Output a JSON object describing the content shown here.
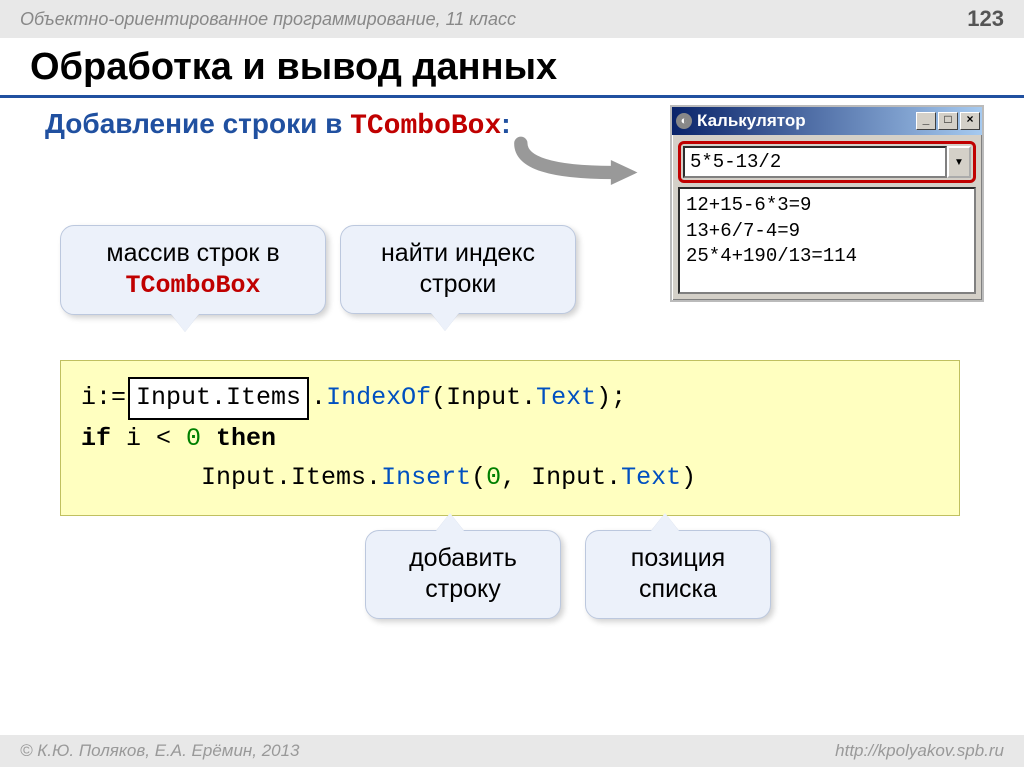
{
  "header": {
    "course": "Объектно-ориентированное программирование, 11 класс",
    "page": "123"
  },
  "title": "Обработка и вывод данных",
  "subtitle": {
    "prefix": "Добавление строки в ",
    "classname": "TComboBox",
    "suffix": ":"
  },
  "window": {
    "title": "Калькулятор",
    "combo_value": "5*5-13/2",
    "list": "12+15-6*3=9\n13+6/7-4=9\n25*4+190/13=114"
  },
  "callouts": {
    "arrayLines": {
      "l1": "массив строк в",
      "l2": "TComboBox"
    },
    "findIndex": {
      "l1": "найти индекс",
      "l2": "строки"
    },
    "addLine": {
      "l1": "добавить",
      "l2": "строку"
    },
    "listPos": {
      "l1": "позиция",
      "l2": "списка"
    }
  },
  "code": {
    "l1_pre": "i:=",
    "l1_box": "Input.Items",
    "l1_dot": ".",
    "l1_method": "IndexOf",
    "l1_open": "(Input.",
    "l1_text": "Text",
    "l1_close": ");",
    "l2_if": "if",
    "l2_mid": " i < ",
    "l2_zero": "0",
    "l2_then": "  then",
    "l3_indent": "        Input.Items.",
    "l3_insert": "Insert",
    "l3_open": "(",
    "l3_zero": "0",
    "l3_mid": ", Input.",
    "l3_text": "Text",
    "l3_close": ")"
  },
  "footer": {
    "left": "© К.Ю. Поляков, Е.А. Ерёмин, 2013",
    "right": "http://kpolyakov.spb.ru"
  }
}
